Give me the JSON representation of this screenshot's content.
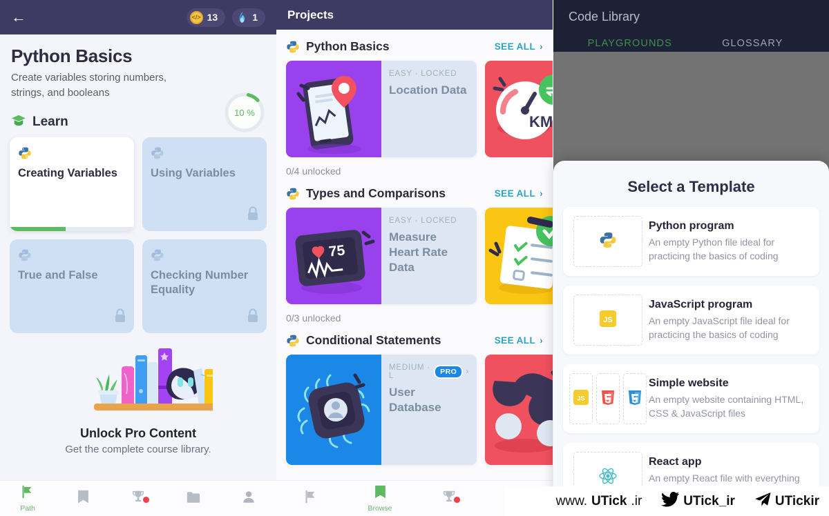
{
  "left_panel": {
    "header": {
      "back_icon": "back-arrow-icon",
      "coin_icon": "coin-icon",
      "coin_count": "13",
      "streak_icon": "flame-icon",
      "streak_count": "1"
    },
    "course": {
      "title": "Python Basics",
      "subtitle": "Create variables storing numbers, strings, and booleans",
      "progress_label": "10 %",
      "progress_percent": 10,
      "progress_color": "#5cbb5f"
    },
    "learn_section": {
      "icon": "graduation-cap-icon",
      "label": "Learn",
      "cards": [
        {
          "title": "Creating Variables",
          "locked": false,
          "active": true,
          "progress_percent": 45,
          "icon": "python-icon"
        },
        {
          "title": "Using Variables",
          "locked": true,
          "active": false,
          "icon": "python-icon"
        },
        {
          "title": "True and False",
          "locked": true,
          "active": false,
          "icon": "python-icon"
        },
        {
          "title": "Checking Number Equality",
          "locked": true,
          "active": false,
          "icon": "python-icon"
        }
      ]
    },
    "promo": {
      "art": "bookshelf-illustration",
      "title": "Unlock Pro Content",
      "subtitle": "Get the complete course library."
    },
    "bottom_nav": [
      {
        "icon": "flag-icon",
        "label": "Path",
        "active": true
      },
      {
        "icon": "book-icon",
        "label": "",
        "active": false
      },
      {
        "icon": "trophy-icon",
        "label": "",
        "active": false,
        "badge": true
      },
      {
        "icon": "folder-icon",
        "label": "",
        "active": false
      },
      {
        "icon": "person-icon",
        "label": "",
        "active": false
      }
    ]
  },
  "mid_panel": {
    "header_title": "Projects",
    "see_all_label": "SEE ALL",
    "groups": [
      {
        "icon": "python-icon",
        "name": "Python Basics",
        "unlocked_text": "0/4 unlocked",
        "cards": [
          {
            "meta": "EASY · LOCKED",
            "title": "Location Data",
            "art": "phone-location-pin-illustration",
            "art_bg": "#9941ed",
            "pro": false
          },
          {
            "meta": "",
            "title": "",
            "art": "speedometer-km-illustration",
            "art_bg": "#f0515f",
            "pro": false
          }
        ]
      },
      {
        "icon": "python-icon",
        "name": "Types and Comparisons",
        "unlocked_text": "0/3 unlocked",
        "cards": [
          {
            "meta": "EASY · LOCKED",
            "title": "Measure Heart Rate Data",
            "art": "heart-rate-monitor-illustration",
            "art_bg": "#9941ed",
            "pro": false
          },
          {
            "meta": "",
            "title": "",
            "art": "checklist-illustration",
            "art_bg": "#fbc513",
            "pro": false
          }
        ]
      },
      {
        "icon": "python-icon",
        "name": "Conditional Statements",
        "unlocked_text": "",
        "cards": [
          {
            "meta": "MEDIUM · L",
            "title": "User Database",
            "art": "chip-user-illustration",
            "art_bg": "#1b87e6",
            "pro": true,
            "pro_label": "PRO"
          },
          {
            "meta": "",
            "title": "",
            "art": "binoculars-illustration",
            "art_bg": "#f0515f",
            "pro": false
          }
        ]
      }
    ],
    "bottom_nav": [
      {
        "icon": "flag-icon",
        "label": "",
        "active": false
      },
      {
        "icon": "book-icon",
        "label": "Browse",
        "active": true
      },
      {
        "icon": "trophy-icon",
        "label": "",
        "active": false,
        "badge": true
      },
      {
        "icon": "folder-icon",
        "label": "",
        "active": false
      }
    ]
  },
  "right_panel": {
    "header_title": "Code Library",
    "tabs": [
      {
        "label": "PLAYGROUNDS",
        "active": true
      },
      {
        "label": "GLOSSARY",
        "active": false
      }
    ],
    "modal": {
      "title": "Select a Template",
      "templates": [
        {
          "name": "Python program",
          "desc": "An empty Python file ideal for practicing the basics of coding",
          "icons": [
            "python-icon"
          ]
        },
        {
          "name": "JavaScript program",
          "desc": "An empty JavaScript file ideal for practicing the basics of coding",
          "icons": [
            "javascript-icon"
          ]
        },
        {
          "name": "Simple website",
          "desc": "An empty website containing HTML, CSS & JavaScript files",
          "icons": [
            "javascript-icon",
            "html5-icon",
            "css3-icon"
          ]
        },
        {
          "name": "React app",
          "desc": "An empty React file with everything needed to create an app",
          "icons": [
            "react-icon"
          ]
        }
      ]
    }
  },
  "watermark": {
    "site_pre": "www.",
    "site_mid": "UTick",
    "site_post": ".ir",
    "twitter_icon": "twitter-bird-icon",
    "twitter_handle": "UTick_ir",
    "telegram_icon": "telegram-paperplane-icon",
    "telegram_handle": "UTickir"
  }
}
